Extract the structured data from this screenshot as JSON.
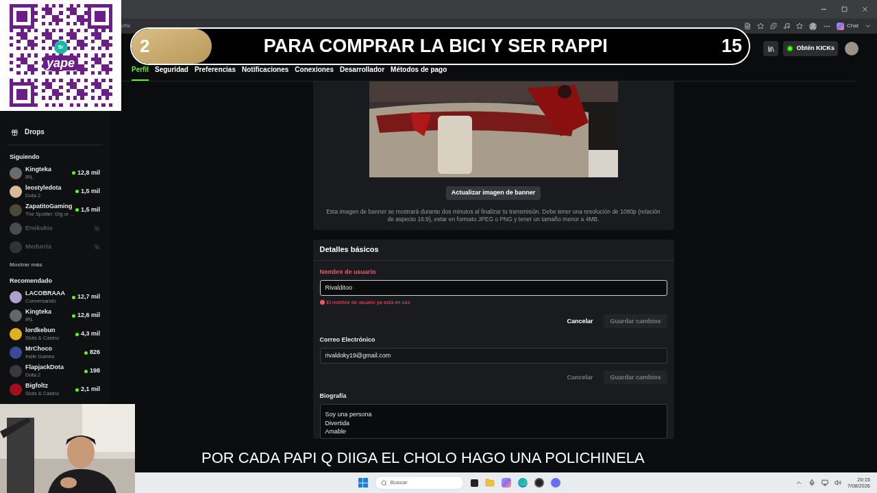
{
  "browser": {
    "address_fragment": "ofile",
    "chat_label": "Chat"
  },
  "qr_overlay": {
    "currency": "S/",
    "brand": "yape"
  },
  "goal_banner": {
    "current": "2",
    "text": "PARA COMPRAR LA BICI Y SER RAPPI",
    "target": "15",
    "level": 0.13
  },
  "header": {
    "kicks_button": "Obtén KICKs"
  },
  "tabs": [
    {
      "label": "Perfil",
      "selected": true
    },
    {
      "label": "Seguridad",
      "selected": false
    },
    {
      "label": "Preferencias",
      "selected": false
    },
    {
      "label": "Notificaciones",
      "selected": false
    },
    {
      "label": "Conexiones",
      "selected": false
    },
    {
      "label": "Desarrollador",
      "selected": false
    },
    {
      "label": "Métodos de pago",
      "selected": false
    }
  ],
  "sidebar": {
    "nav": [
      {
        "label": "Drops"
      }
    ],
    "following_title": "Siguiendo",
    "following": [
      {
        "name": "Kingteka",
        "sub": "IRL",
        "viewers": "12,8 mil",
        "live": true
      },
      {
        "name": "leostyledota",
        "sub": "Dota 2",
        "viewers": "1,5 mil",
        "live": true
      },
      {
        "name": "ZapatitoGaming",
        "sub": "The Spotter: Dig or ...",
        "viewers": "1,5 mil",
        "live": true
      },
      {
        "name": "Emikukis",
        "live": false
      },
      {
        "name": "Medurria",
        "live": false
      }
    ],
    "show_more": "Mostrar más",
    "recommended_title": "Recomendado",
    "recommended": [
      {
        "name": "LACOBRAAA",
        "sub": "Conversando",
        "viewers": "12,7 mil",
        "live": true
      },
      {
        "name": "Kingteka",
        "sub": "IRL",
        "viewers": "12,6 mil",
        "live": true
      },
      {
        "name": "lordkebun",
        "sub": "Slots & Casino",
        "viewers": "4,3 mil",
        "live": true
      },
      {
        "name": "MrChoco",
        "sub": "Indie Games",
        "viewers": "826",
        "live": true
      },
      {
        "name": "FlapjackDota",
        "sub": "Dota 2",
        "viewers": "198",
        "live": true
      },
      {
        "name": "Bigfoltz",
        "sub": "Slots & Casino",
        "viewers": "2,1 mil",
        "live": true
      }
    ]
  },
  "banner": {
    "button": "Actualizar imagen de banner",
    "help": "Esta imagen de banner se mostrará durante dos minutos al finalizar tu transmisión. Debe tener una resolución de 1080p (relación de aspecto 16:9), estar en formato JPEG o PNG y tener un tamaño menor a 4MB."
  },
  "basic": {
    "title": "Detalles básicos",
    "fields": [
      {
        "kind": "input",
        "label": "Nombre de usuario",
        "value": "Rivalditoo",
        "error": "El nombre de usuario ya está en uso",
        "cancel": {
          "label": "Cancelar",
          "disabled": false
        },
        "save": {
          "label": "Guardar cambios",
          "disabled": true
        }
      },
      {
        "kind": "input",
        "label": "Correo Electrónico",
        "value": "rivaldoky19@gmail.com",
        "cancel": {
          "label": "Cancelar",
          "disabled": true
        },
        "save": {
          "label": "Guardar cambios",
          "disabled": true
        }
      },
      {
        "kind": "textarea",
        "label": "Biografía",
        "lines": [
          "Soy una persona",
          "Divertida",
          "Amable"
        ]
      }
    ]
  },
  "subtitle": "POR CADA PAPI Q DIIGA EL CHOLO HAGO UNA POLICHINELA",
  "taskbar": {
    "search_placeholder": "Buscar",
    "time": "20:15",
    "date": "7/08/2026"
  }
}
